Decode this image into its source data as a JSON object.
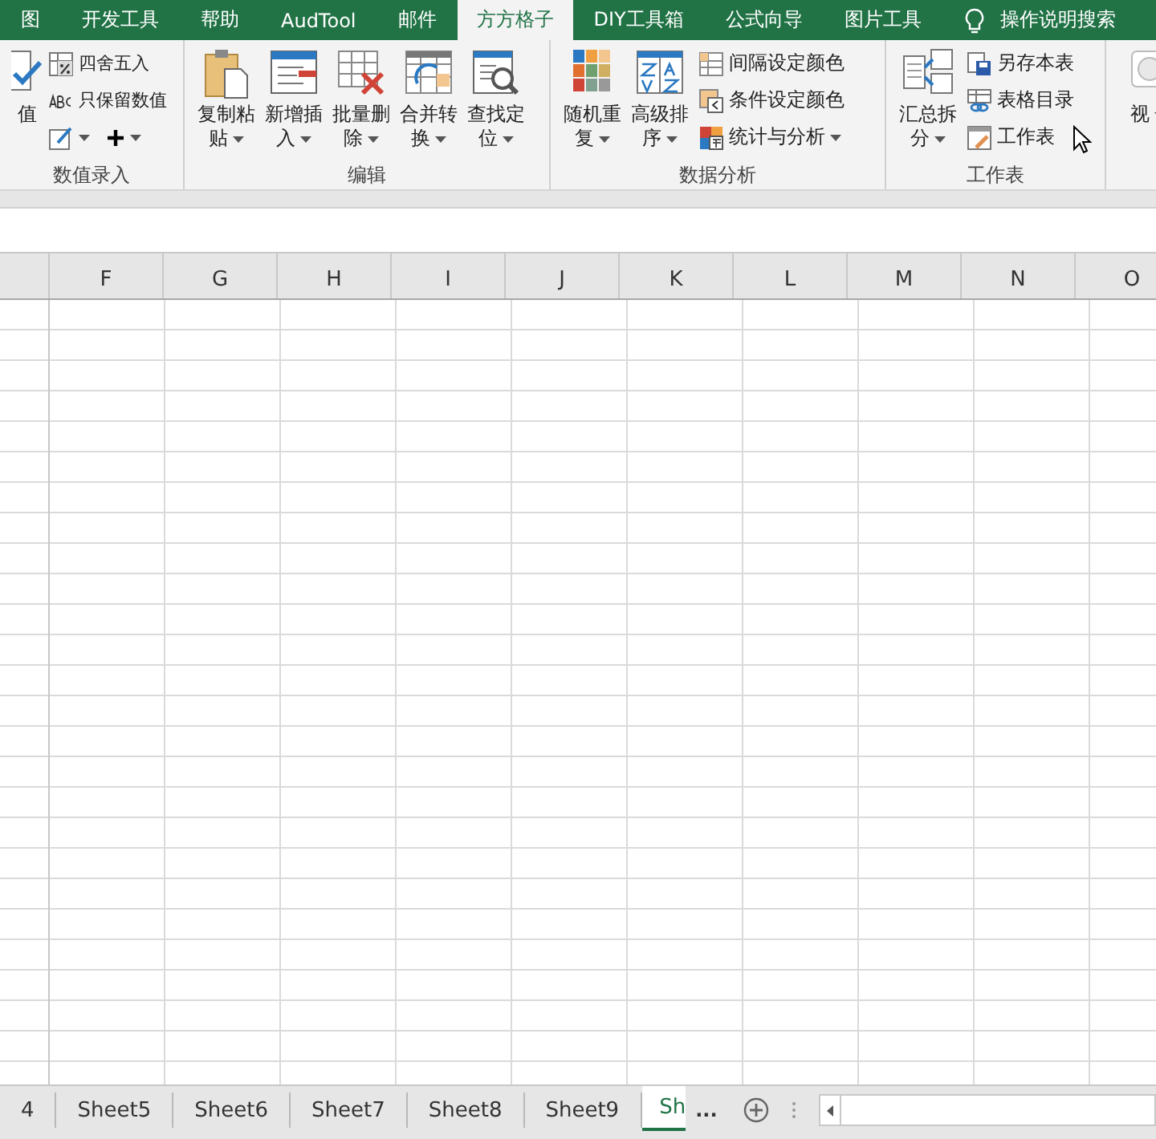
{
  "ribbon_tabs": [
    {
      "label": "图",
      "selected": false
    },
    {
      "label": "开发工具",
      "selected": false
    },
    {
      "label": "帮助",
      "selected": false
    },
    {
      "label": "AudTool",
      "selected": false
    },
    {
      "label": "邮件",
      "selected": false
    },
    {
      "label": "方方格子",
      "selected": true
    },
    {
      "label": "DIY工具箱",
      "selected": false
    },
    {
      "label": "公式向导",
      "selected": false
    },
    {
      "label": "图片工具",
      "selected": false
    }
  ],
  "tell_me": {
    "label": "操作说明搜索"
  },
  "ribbon_groups": [
    {
      "label": "数值录入",
      "large_buttons": [
        {
          "lines": [
            "值"
          ],
          "dropdown": false
        }
      ],
      "small_buttons": [
        {
          "kind": "labeled",
          "label": "四舍五入",
          "dropdown": false
        },
        {
          "kind": "labeled",
          "label": "只保留数值",
          "dropdown": false
        },
        {
          "kind": "icon_only",
          "dropdown": true
        },
        {
          "kind": "icon_only",
          "dropdown": true
        }
      ]
    },
    {
      "label": "编辑",
      "large_buttons": [
        {
          "lines": [
            "复制粘",
            "贴"
          ],
          "dropdown": true
        },
        {
          "lines": [
            "新增插",
            "入"
          ],
          "dropdown": true
        },
        {
          "lines": [
            "批量删",
            "除"
          ],
          "dropdown": true
        },
        {
          "lines": [
            "合并转",
            "换"
          ],
          "dropdown": true
        },
        {
          "lines": [
            "查找定",
            "位"
          ],
          "dropdown": true
        }
      ]
    },
    {
      "label": "数据分析",
      "large_buttons": [
        {
          "lines": [
            "随机重",
            "复"
          ],
          "dropdown": true
        },
        {
          "lines": [
            "高级排",
            "序"
          ],
          "dropdown": true
        }
      ],
      "small_buttons": [
        {
          "kind": "labeled",
          "label": "间隔设定颜色",
          "dropdown": false
        },
        {
          "kind": "labeled",
          "label": "条件设定颜色",
          "dropdown": false
        },
        {
          "kind": "labeled",
          "label": "统计与分析",
          "dropdown": true
        }
      ]
    },
    {
      "label": "工作表",
      "large_buttons": [
        {
          "lines": [
            "汇总拆",
            "分"
          ],
          "dropdown": true
        }
      ],
      "small_buttons": [
        {
          "kind": "labeled",
          "label": "另存本表",
          "dropdown": false
        },
        {
          "kind": "labeled",
          "label": "表格目录",
          "dropdown": false
        },
        {
          "kind": "labeled",
          "label": "工作表",
          "dropdown": false
        }
      ]
    },
    {
      "large_buttons": [
        {
          "lines": [
            "视"
          ],
          "dropdown": true
        }
      ]
    }
  ],
  "columns": [
    "F",
    "G",
    "H",
    "I",
    "J",
    "K",
    "L",
    "M",
    "N",
    "O"
  ],
  "sheet_tabs": [
    {
      "label": "4",
      "selected": false
    },
    {
      "label": "Sheet5",
      "selected": false
    },
    {
      "label": "Sheet6",
      "selected": false
    },
    {
      "label": "Sheet7",
      "selected": false
    },
    {
      "label": "Sheet8",
      "selected": false
    },
    {
      "label": "Sheet9",
      "selected": false
    },
    {
      "label": "Sh",
      "selected": true
    }
  ],
  "more_sheets": "..."
}
